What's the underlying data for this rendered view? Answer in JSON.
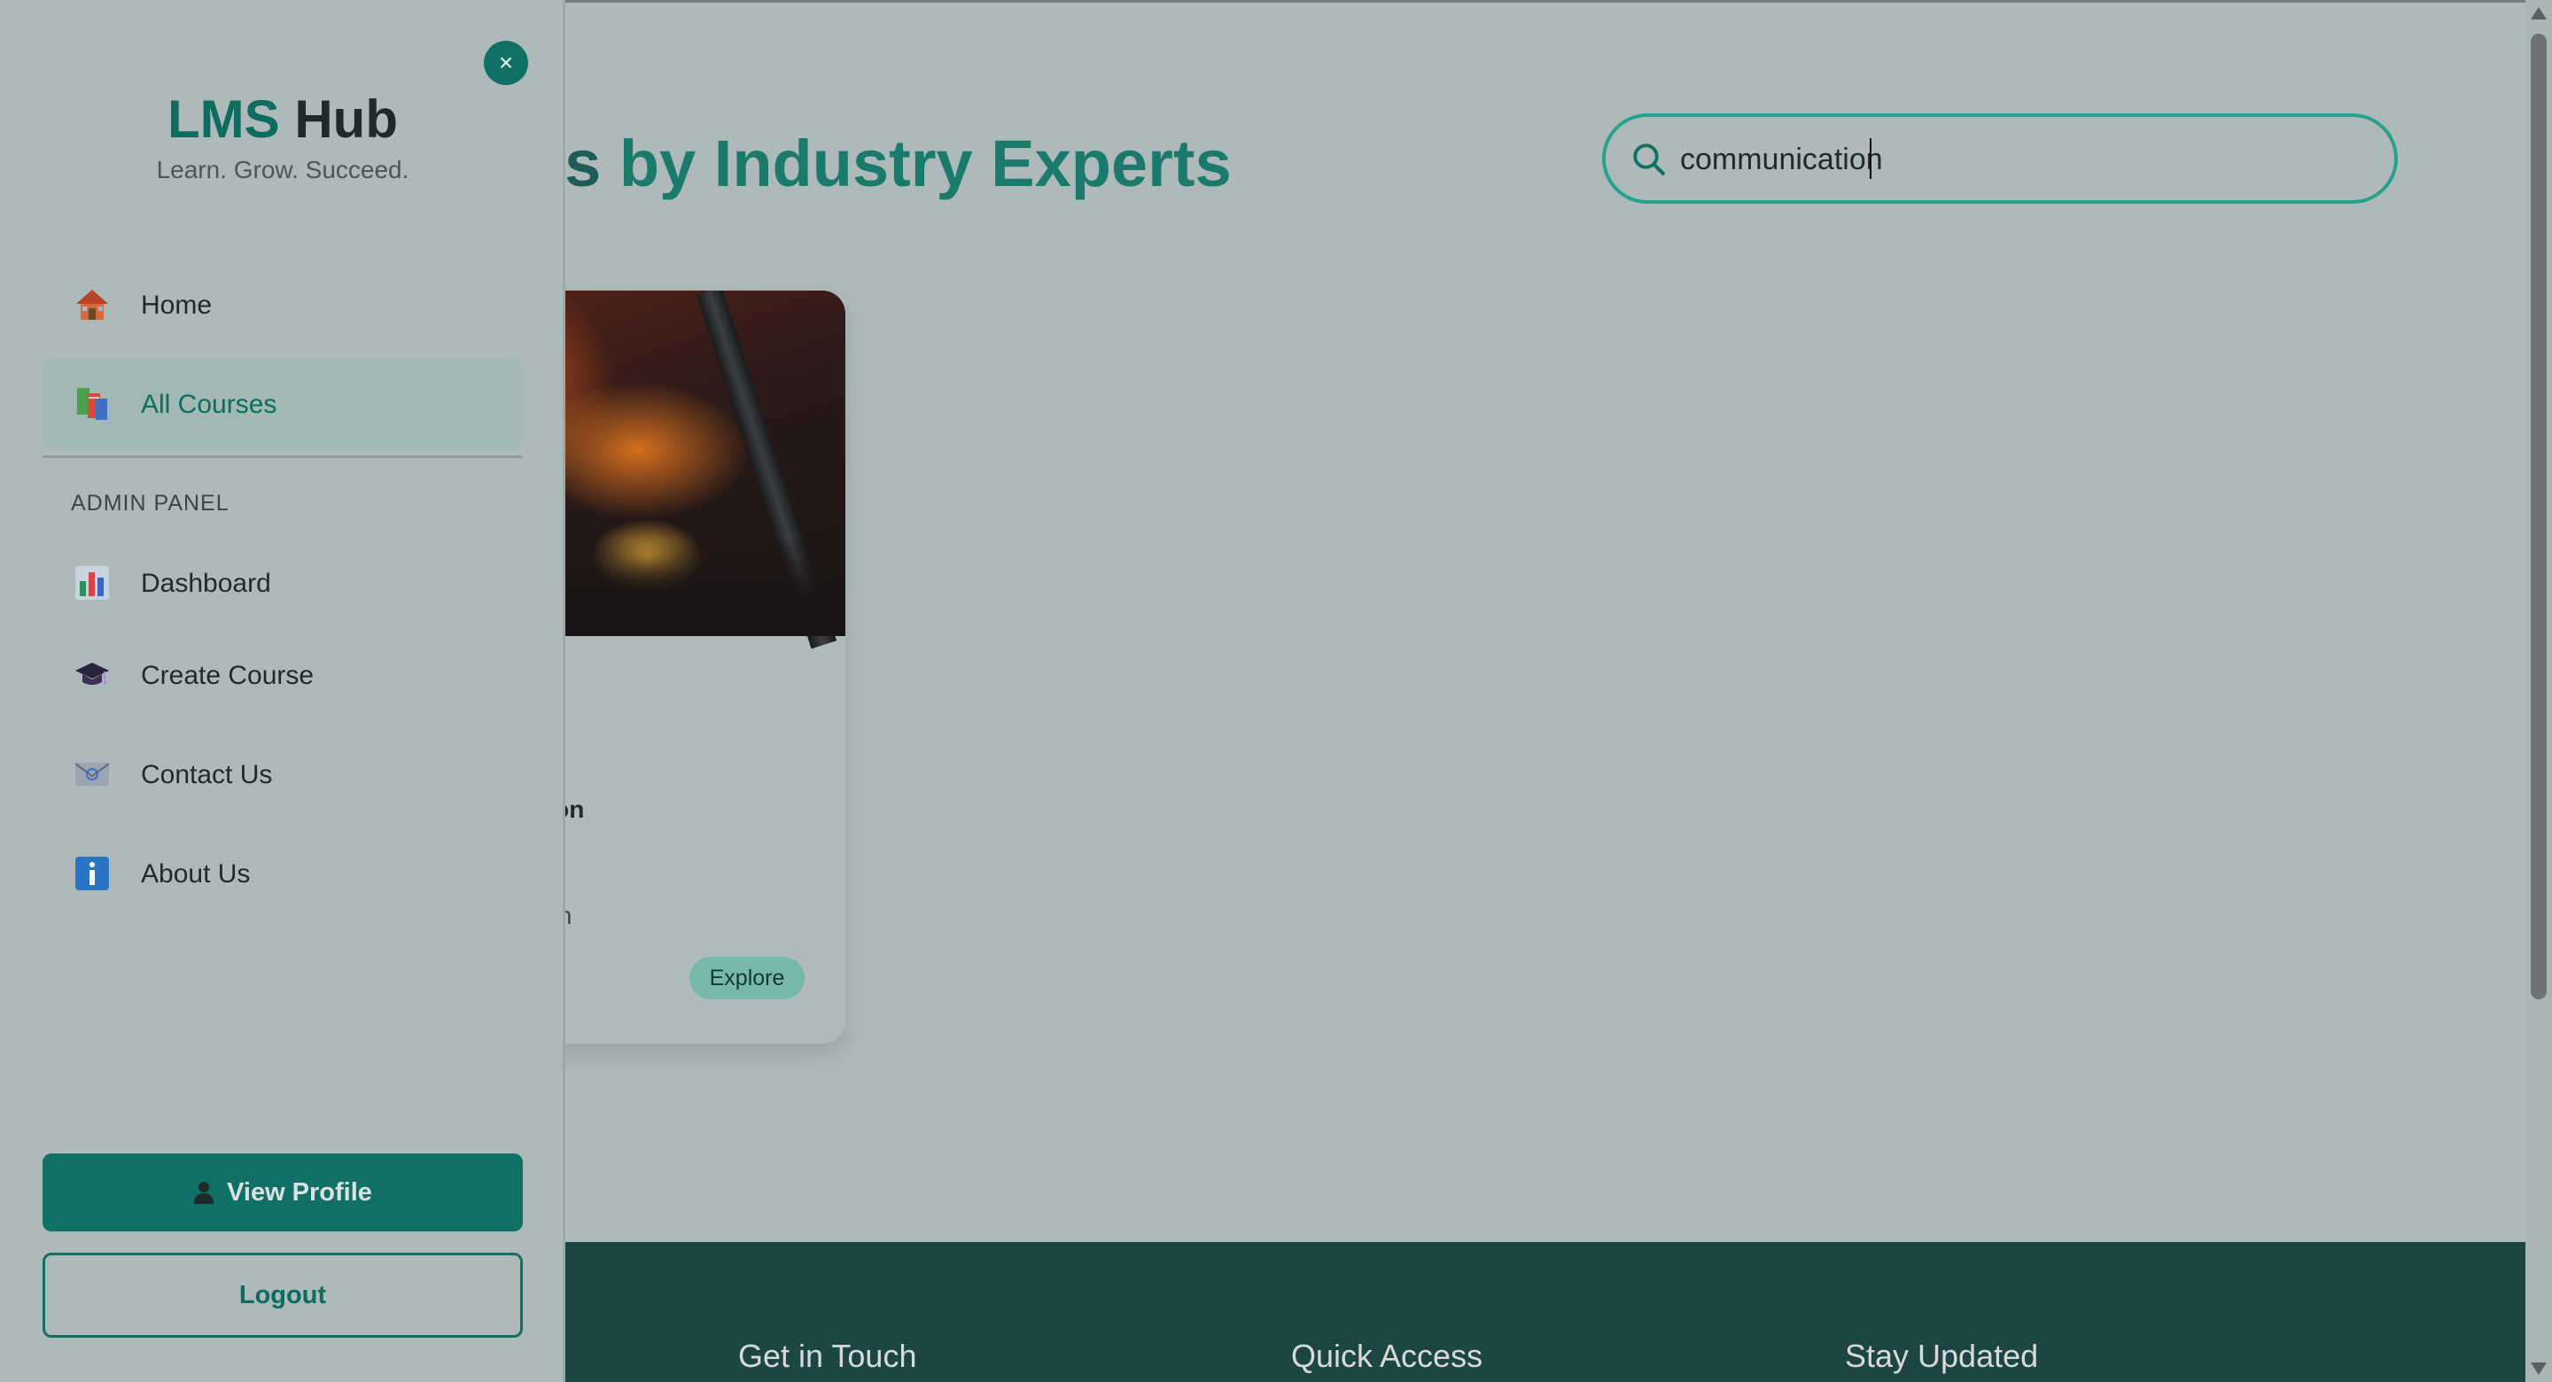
{
  "hero": {
    "title_visible": "es by Industry Experts",
    "title_partial_prefix": "es ",
    "title_main": "by Industry Experts"
  },
  "search": {
    "value": "communication",
    "placeholder": ""
  },
  "course_card": {
    "title": "munication",
    "category": "munication",
    "explore_label": "Explore"
  },
  "footer": {
    "headings": [
      "Get in Touch",
      "Quick Access",
      "Stay Updated"
    ]
  },
  "sidebar": {
    "close_label": "×",
    "brand_lms": "LMS",
    "brand_hub": "Hub",
    "tagline": "Learn. Grow. Succeed.",
    "items": [
      {
        "label": "Home",
        "icon": "house-icon"
      },
      {
        "label": "All Courses",
        "icon": "books-icon",
        "active": true
      }
    ],
    "admin_section_label": "ADMIN PANEL",
    "admin_items": [
      {
        "label": "Dashboard",
        "icon": "bar-chart-icon"
      },
      {
        "label": "Create Course",
        "icon": "graduation-cap-icon"
      },
      {
        "label": "Contact Us",
        "icon": "envelope-icon"
      },
      {
        "label": "About Us",
        "icon": "info-icon"
      }
    ],
    "view_profile_label": "View Profile",
    "logout_label": "Logout"
  },
  "colors": {
    "accent": "#117066",
    "brand_text": "#0d6b60",
    "search_border": "#25a18d",
    "footer_bg": "#1c4644",
    "overlay_bg": "#aebab9"
  }
}
